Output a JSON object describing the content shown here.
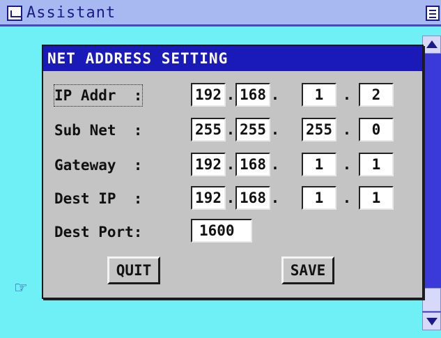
{
  "app": {
    "title": "Assistant"
  },
  "dialog": {
    "title": "NET ADDRESS SETTING",
    "rows": [
      {
        "label": "IP Addr  :",
        "octets": [
          "192",
          "168",
          "1",
          "2"
        ]
      },
      {
        "label": "Sub Net  :",
        "octets": [
          "255",
          "255",
          "255",
          "0"
        ]
      },
      {
        "label": "Gateway  :",
        "octets": [
          "192",
          "168",
          "1",
          "1"
        ]
      },
      {
        "label": "Dest IP  :",
        "octets": [
          "192",
          "168",
          "1",
          "1"
        ]
      }
    ],
    "port": {
      "label": "Dest Port:",
      "value": "1600"
    },
    "dot": ".",
    "buttons": {
      "quit": "QUIT",
      "save": "SAVE"
    }
  },
  "icons": {
    "app": "app-window-icon",
    "menu": "menu-list-icon",
    "pointer": "pointing-hand-icon",
    "scroll_up": "triangle-up-icon",
    "scroll_down": "triangle-down-icon"
  },
  "colors": {
    "desktop": "#6ff0f7",
    "title_bar": "#a8b8f0",
    "dialog_header": "#1a1ab8",
    "dialog_body": "#c4c4c4",
    "scrollbar": "#3a3ad8"
  }
}
